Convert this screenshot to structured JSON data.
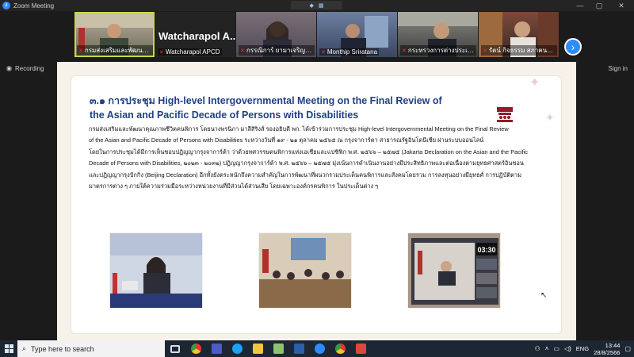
{
  "window": {
    "title": "Zoom Meeting"
  },
  "participants": [
    {
      "name": "กรมส่งเสริมและพัฒนาคุณ...",
      "muted": true,
      "active": true
    },
    {
      "name": "Watcharapol APCD",
      "muted": true,
      "active": false
    },
    {
      "name": "กรรณิการ์ ยามาเจริญ ผู้แ...",
      "muted": true,
      "active": false
    },
    {
      "name": "Monthip Sriratana",
      "muted": true,
      "active": false
    },
    {
      "name": "กระทรวงการต่างประเทศ",
      "muted": true,
      "active": false
    },
    {
      "name": "รัตน์ กิจธรรม สภาคนพิการ...",
      "muted": true,
      "active": false
    }
  ],
  "speaker_label": "Watcharapol A...",
  "recording_label": "Recording",
  "signin_label": "Sign in",
  "slide": {
    "heading_line1": "๓.๑ การประชุม High-level Intergovernmental Meeting on the Final Review of",
    "heading_line2": "the Asian and Pacific Decade of Persons with Disabilities",
    "paragraph": [
      "กรมส่งเสริมและพัฒนาคุณภาพชีวิตคนพิการ โดยนางพรนิภา มาลีสิริงส์ รองอธิบดี พก. ได้เข้าร่วมการประชุม High-level Intergovernmental Meeting on the Final Review",
      "of the Asian and Pacific Decade of Persons with Disabilities ระหว่างวันที่ ๑๙ - ๒๑ ตุลาคม ๒๕๖๕ ณ กรุงจาการ์ตา สาธารณรัฐอินโดนีเซีย ผ่านระบบออนไลน์",
      "โดยในการประชุมได้มีการเห็นชอบปฏิญญากรุงจาการ์ต้า ว่าด้วยทศวรรษคนพิการแห่งเอเชียและแปซิฟิก พ.ศ. ๒๕๖๖ – ๒๕๗๕ (Jakarta Declaration on the Asian and the Pacific",
      "Decade of Persons with Disabilities, ๒๐๒๓ - ๒๐๓๒) ปฏิญญากรุงจาการ์ต้า พ.ศ. ๒๕๖๖ – ๒๕๗๕ มุ่งเน้นการดำเนินงานอย่างมีประสิทธิภาพและต่อเนื่องตามยุทธศาสตร์อินชอน",
      "และปฏิญญากรุงปักกิ่ง (Beijing Declaration) อีกทั้งยังตระหนักถึงความสำคัญในการพัฒนาที่ผนวกรวมประเด็นคนพิการและสังคมโดยรวม การลงทุนอย่างมียุทธศ์ การปฏิบัติตาม",
      "มาตรการต่าง ๆ ภายใต้ความร่วมมือระหว่างหน่วยงานที่มีส่วนได้ส่วนเสีย โดยเฉพาะองค์กรคนพิการ ในประเด็นต่าง ๆ"
    ],
    "photo2_timer": "03:30"
  },
  "taskbar": {
    "search_placeholder": "Type here to search",
    "language": "ENG",
    "time": "13:44",
    "date": "28/8/2566"
  }
}
